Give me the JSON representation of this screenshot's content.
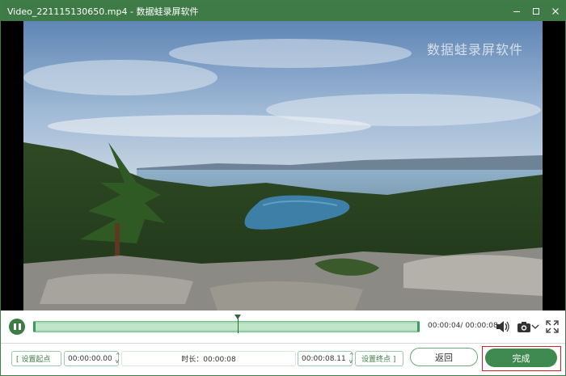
{
  "window": {
    "title": "Video_221115130650.mp4  -  数据蛙录屏软件",
    "controls": [
      "minimize-icon",
      "maximize-icon",
      "close-icon"
    ]
  },
  "video": {
    "watermark": "数据蛙录屏软件"
  },
  "playback": {
    "state_icon": "pause-icon",
    "time_display": "00:00:04/ 00:00:08",
    "progress": 0.53,
    "icons": [
      "volume-icon",
      "camera-icon",
      "fullscreen-icon"
    ]
  },
  "trim": {
    "set_start_label": "[ 设置起点",
    "start_time": "00:00:00.00",
    "duration_label": "时长：00:00:08",
    "end_time": "00:00:08.11",
    "set_end_label": "设置终点 ]"
  },
  "actions": {
    "back_label": "返回",
    "done_label": "完成"
  },
  "colors": {
    "accent": "#3e7b47",
    "highlight_border": "#d61f26"
  }
}
